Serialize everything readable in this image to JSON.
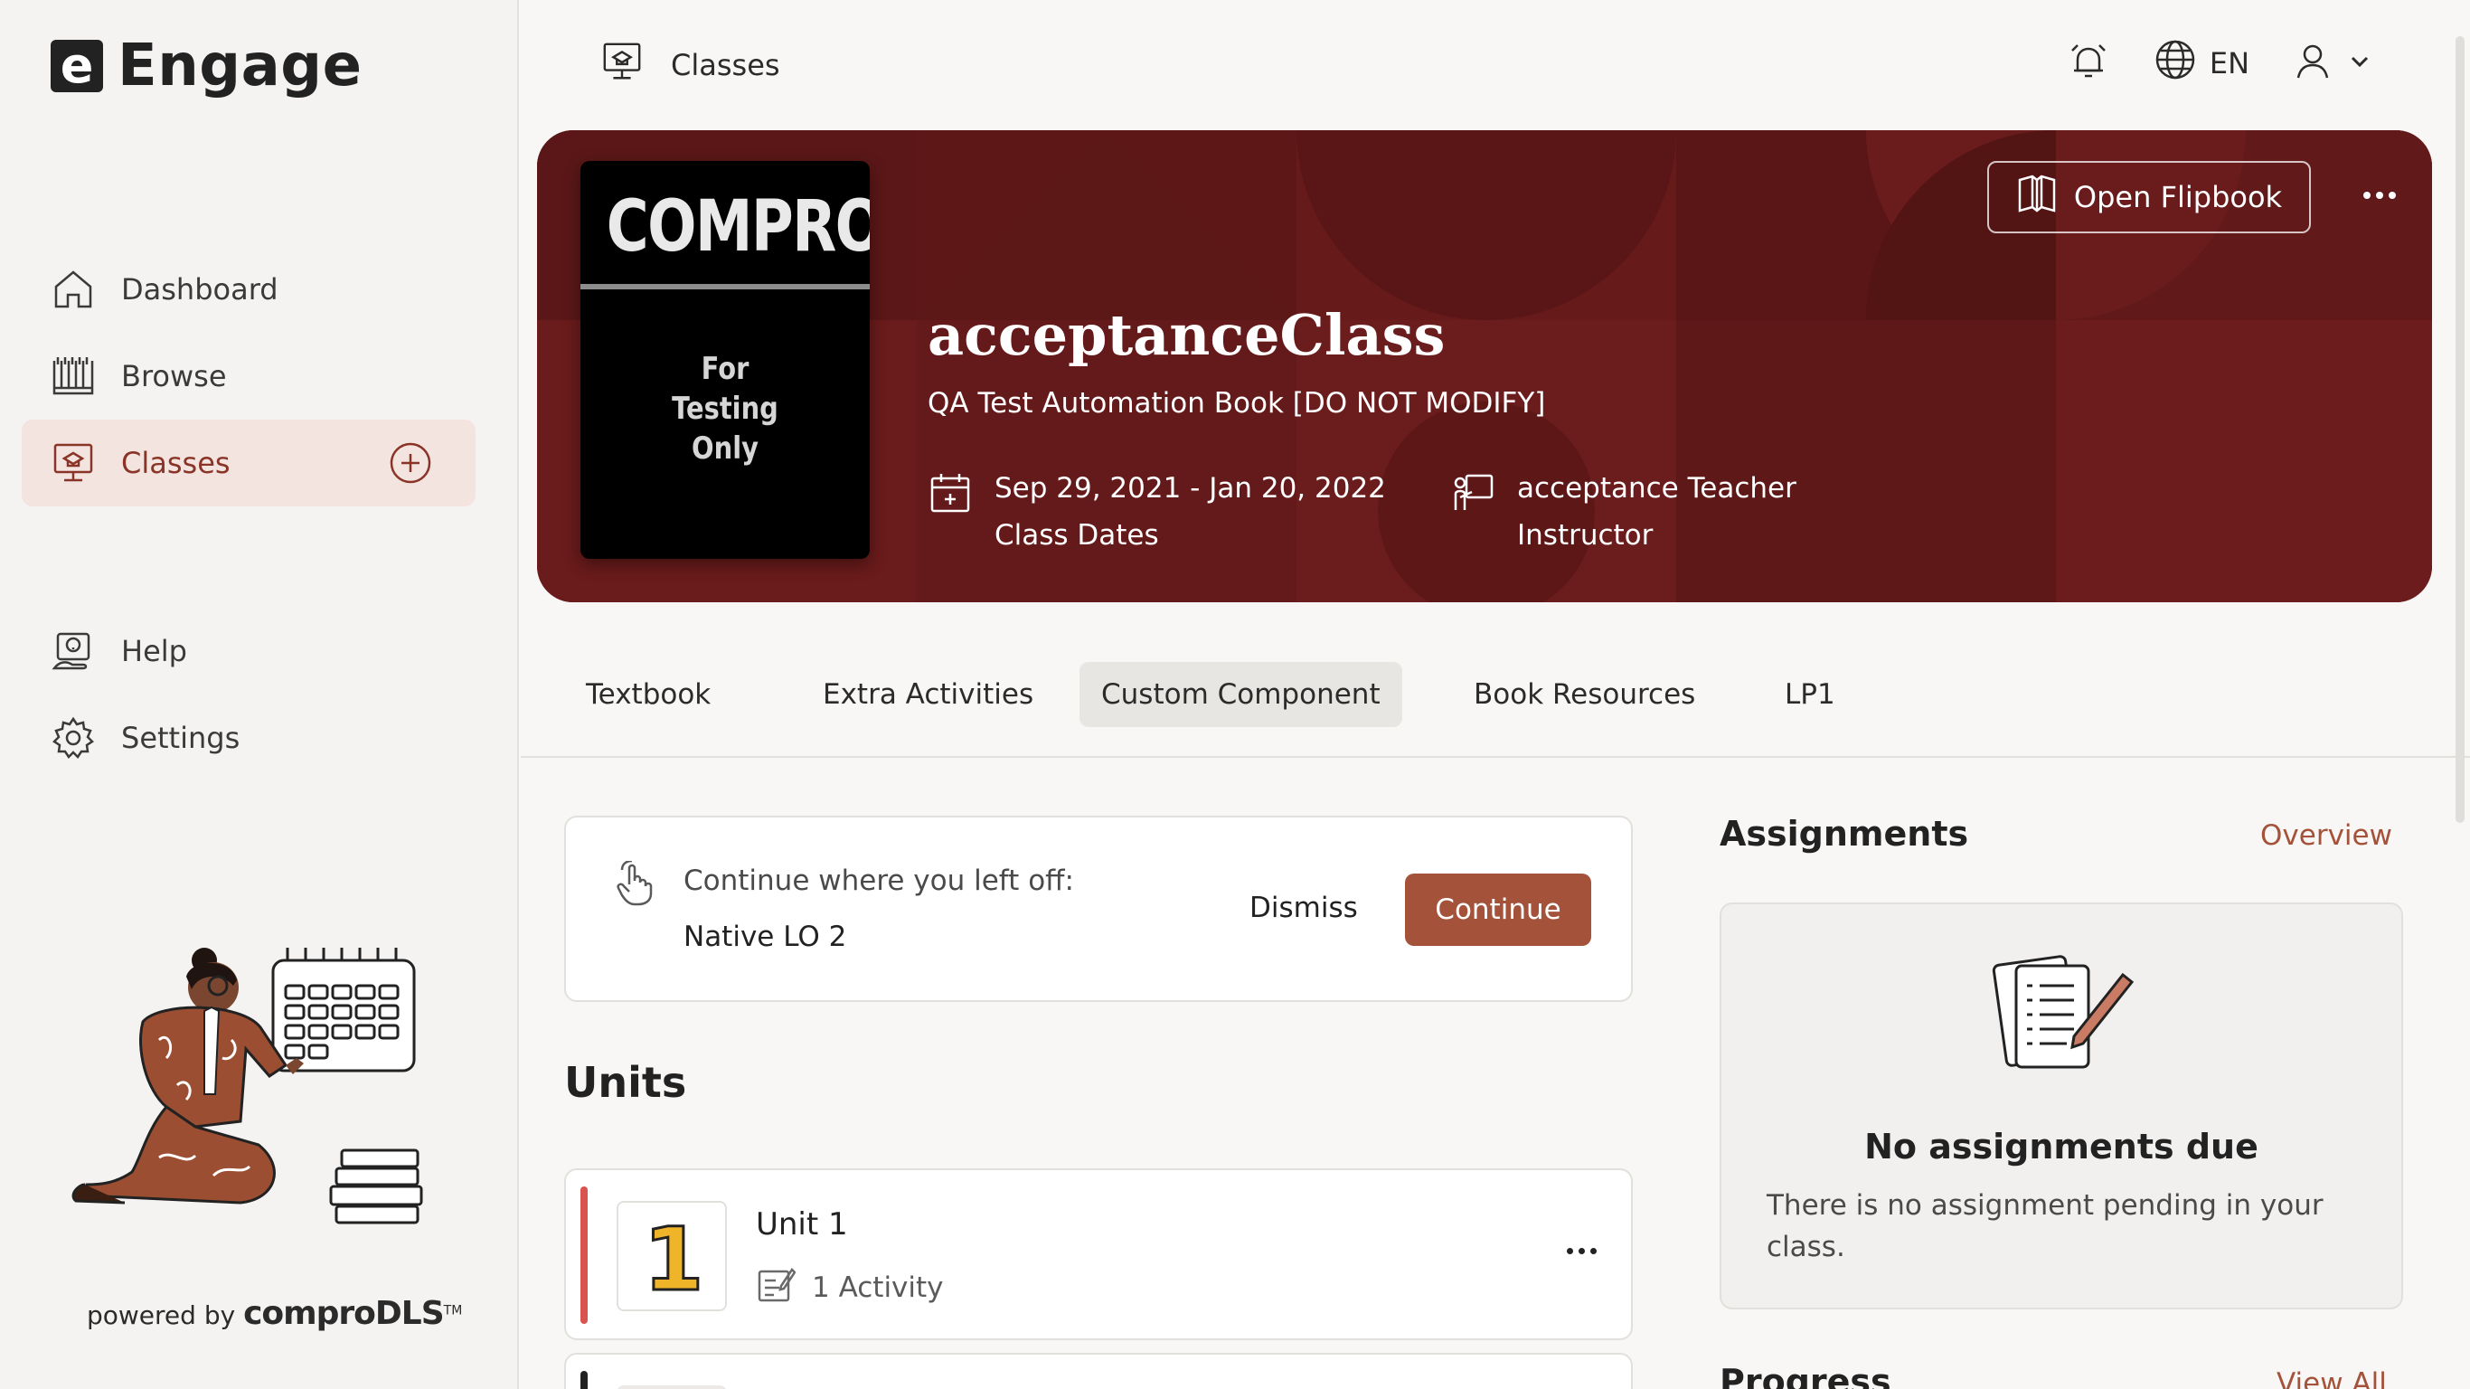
{
  "app": {
    "logo_letter": "e",
    "name": "Engage"
  },
  "sidebar": {
    "items": [
      {
        "label": "Dashboard",
        "icon": "home-icon"
      },
      {
        "label": "Browse",
        "icon": "books-icon"
      },
      {
        "label": "Classes",
        "icon": "classroom-icon",
        "active": true
      },
      {
        "label": "Help",
        "icon": "help-icon"
      },
      {
        "label": "Settings",
        "icon": "gear-icon"
      }
    ],
    "powered_prefix": "powered by",
    "powered_brand": "comproDLS",
    "powered_tm": "TM"
  },
  "topbar": {
    "breadcrumb": "Classes",
    "language": "EN"
  },
  "hero": {
    "cover_title": "COMPRO",
    "cover_subtitle": "For\nTesting\nOnly",
    "title": "acceptanceClass",
    "subtitle": "QA Test Automation Book [DO NOT MODIFY]",
    "dates": "Sep 29, 2021 - Jan 20, 2022",
    "dates_label": "Class Dates",
    "instructor": "acceptance Teacher",
    "instructor_label": "Instructor",
    "open_flipbook": "Open Flipbook"
  },
  "tabs": [
    "Textbook",
    "Extra Activities",
    "Custom Component",
    "Book Resources",
    "LP1"
  ],
  "active_tab": "Custom Component",
  "continue_card": {
    "label": "Continue where you left off:",
    "value": "Native LO 2",
    "dismiss": "Dismiss",
    "continue": "Continue"
  },
  "units": {
    "heading": "Units",
    "items": [
      {
        "number": "1",
        "title": "Unit 1",
        "activities": "1 Activity"
      }
    ]
  },
  "assignments": {
    "heading": "Assignments",
    "overview": "Overview",
    "empty_title": "No assignments due",
    "empty_text": "There is no assignment pending in your class."
  },
  "progress": {
    "heading": "Progress",
    "view_all": "View All"
  },
  "colors": {
    "accent": "#a4523a",
    "hero_bg": "#6e1c1c",
    "active_nav_bg": "#f3e4e0",
    "unit_bar": "#d9534f"
  }
}
